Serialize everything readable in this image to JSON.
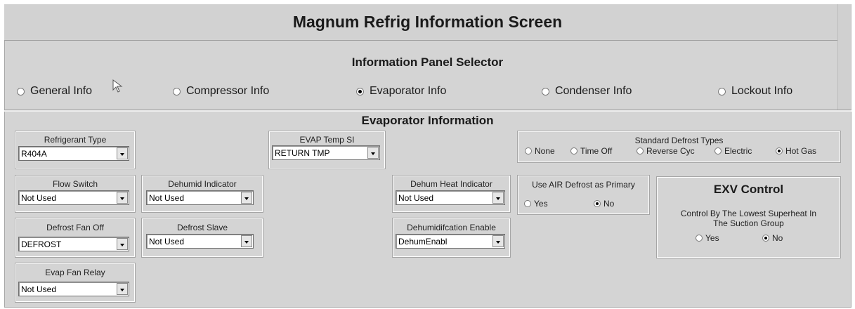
{
  "header": {
    "title": "Magnum Refrig Information Screen"
  },
  "selector": {
    "title": "Information Panel Selector",
    "options": [
      {
        "label": "General Info",
        "selected": false
      },
      {
        "label": "Compressor Info",
        "selected": false
      },
      {
        "label": "Evaporator Info",
        "selected": true
      },
      {
        "label": "Condenser Info",
        "selected": false
      },
      {
        "label": "Lockout Info",
        "selected": false
      }
    ]
  },
  "evaporator": {
    "title": "Evaporator Information",
    "refrigerant_type": {
      "label": "Refrigerant Type",
      "value": "R404A"
    },
    "flow_switch": {
      "label": "Flow Switch",
      "value": "Not Used"
    },
    "defrost_fan_off": {
      "label": "Defrost Fan Off",
      "value": "DEFROST"
    },
    "evap_fan_relay": {
      "label": "Evap Fan Relay",
      "value": "Not Used"
    },
    "dehumid_indicator": {
      "label": "Dehumid Indicator",
      "value": "Not Used"
    },
    "defrost_slave": {
      "label": "Defrost Slave",
      "value": "Not Used"
    },
    "evap_temp_si": {
      "label": "EVAP Temp SI",
      "value": "RETURN TMP"
    },
    "dehum_heat_indicator": {
      "label": "Dehum Heat Indicator",
      "value": "Not Used"
    },
    "dehumidification_enable": {
      "label": "Dehumidifcation Enable",
      "value": "DehumEnabl"
    },
    "standard_defrost": {
      "label": "Standard Defrost Types",
      "options": [
        {
          "label": "None",
          "selected": false
        },
        {
          "label": "Time Off",
          "selected": false
        },
        {
          "label": "Reverse Cyc",
          "selected": false
        },
        {
          "label": "Electric",
          "selected": false
        },
        {
          "label": "Hot Gas",
          "selected": true
        }
      ]
    },
    "air_defrost": {
      "label": "Use AIR Defrost as Primary",
      "options": [
        {
          "label": "Yes",
          "selected": false
        },
        {
          "label": "No",
          "selected": true
        }
      ]
    },
    "exv_control": {
      "title": "EXV Control",
      "line1": "Control By The Lowest Superheat In",
      "line2": "The Suction Group",
      "options": [
        {
          "label": "Yes",
          "selected": false
        },
        {
          "label": "No",
          "selected": true
        }
      ]
    }
  }
}
